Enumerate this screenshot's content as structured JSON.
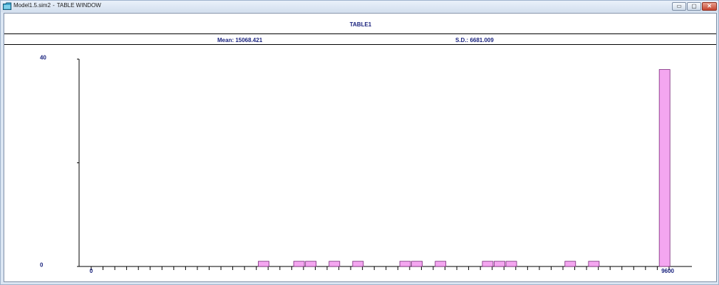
{
  "window": {
    "file_name": "Model1.5.sim2",
    "separator": "-",
    "window_name": "TABLE WINDOW",
    "minimize_glyph": "▭",
    "maximize_glyph": "▢",
    "close_glyph": "✕",
    "icon": "folder-icon"
  },
  "table": {
    "title": "TABLE1",
    "mean_label": "Mean: 15068.421",
    "sd_label": "S.D.: 6681.009"
  },
  "chart_data": {
    "type": "bar",
    "title": "TABLE1",
    "xlabel": "",
    "ylabel": "",
    "ylim": [
      0,
      40
    ],
    "y_ticks": [
      0,
      40
    ],
    "xlim": [
      0,
      9600
    ],
    "x_tick_labels": [
      "0",
      "9600"
    ],
    "bar_color": "#f4a6f0",
    "bar_outline": "#7a2a7a",
    "bin_count": 49,
    "values": [
      0,
      0,
      0,
      0,
      0,
      0,
      0,
      0,
      0,
      0,
      0,
      0,
      0,
      0,
      1,
      0,
      0,
      1,
      1,
      0,
      1,
      0,
      1,
      0,
      0,
      0,
      1,
      1,
      0,
      1,
      0,
      0,
      0,
      1,
      1,
      1,
      0,
      0,
      0,
      0,
      1,
      0,
      1,
      0,
      0,
      0,
      0,
      0,
      38
    ]
  }
}
